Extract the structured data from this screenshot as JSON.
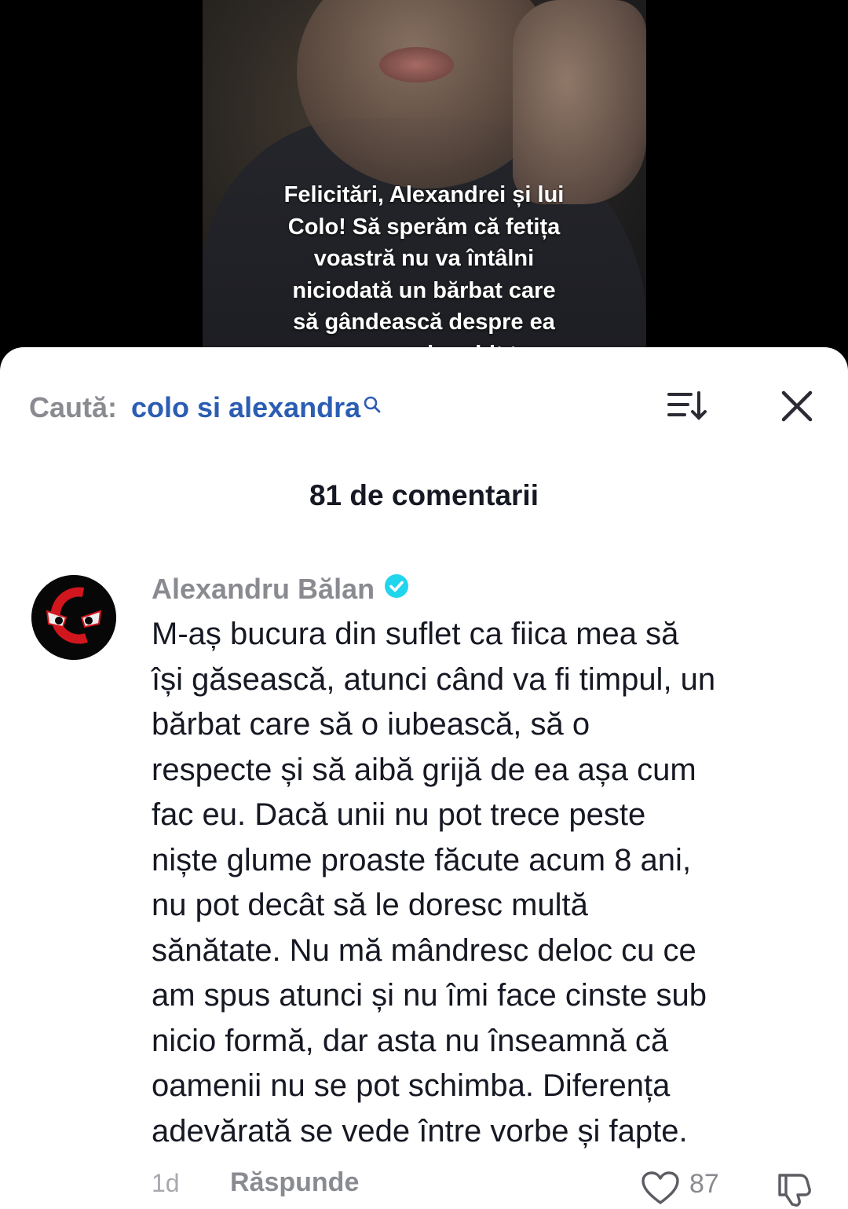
{
  "video": {
    "caption_lines": [
      "Felicitări, Alexandrei și lui",
      "Colo! Să sperăm că fetița",
      "voastră nu va întâlni",
      "niciodată un bărbat care",
      "să gândească despre ea",
      "așa cum ai vorbit tu"
    ]
  },
  "header": {
    "search_label": "Caută:",
    "search_query": "colo si alexandra",
    "icons": [
      "search-icon",
      "sort-icon",
      "close-icon"
    ]
  },
  "comments": {
    "count_label": "81 de comentarii",
    "items": [
      {
        "author": "Alexandru Bălan",
        "verified": true,
        "text_lines": [
          "M-aș bucura din suflet ca fiica mea să",
          "își găsească, atunci când va fi timpul, un",
          "bărbat care să o iubească, să o",
          "respecte și să aibă grijă de ea așa cum",
          "fac eu. Dacă unii nu pot trece peste",
          "niște glume proaste făcute acum 8 ani,",
          "nu pot decât să le doresc multă",
          "sănătate. Nu mă mândresc deloc cu ce",
          "am spus atunci și nu îmi face cinste sub",
          "nicio formă, dar asta nu înseamnă că",
          "oamenii nu se pot schimba. Diferența",
          "adevărată se vede între vorbe și fapte."
        ],
        "time_ago": "1d",
        "reply_label": "Răspunde",
        "likes": "87"
      }
    ]
  },
  "colors": {
    "query_blue": "#2b5db3",
    "verified_cyan": "#20d5ec",
    "avatar_red": "#d2161e",
    "muted_gray": "#8a8b91"
  }
}
